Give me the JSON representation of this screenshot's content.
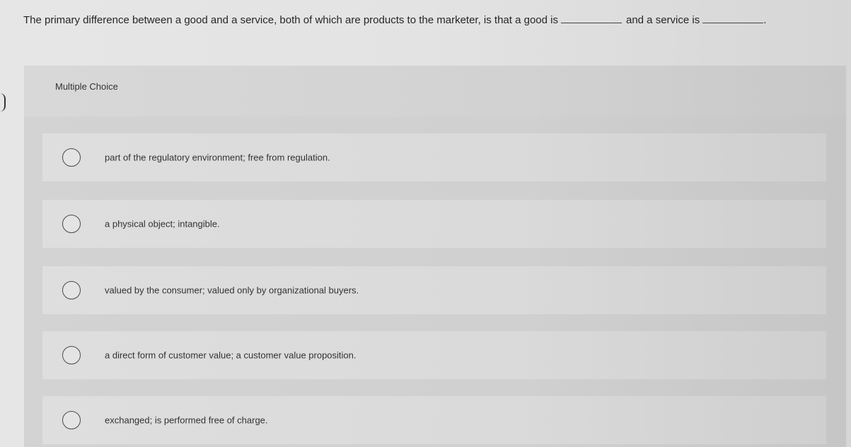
{
  "question": {
    "part1": "The primary difference between a good and a service, both of which are products to the marketer, is that a good is",
    "part2": "and a service is",
    "part3": "."
  },
  "question_type": "Multiple Choice",
  "options": [
    {
      "label": "part of the regulatory environment; free from regulation.",
      "selected": false
    },
    {
      "label": "a physical object; intangible.",
      "selected": false
    },
    {
      "label": "valued by the consumer; valued only by organizational buyers.",
      "selected": false
    },
    {
      "label": "a direct form of customer value; a customer value proposition.",
      "selected": false
    },
    {
      "label": "exchanged; is performed free of charge.",
      "selected": false
    }
  ]
}
